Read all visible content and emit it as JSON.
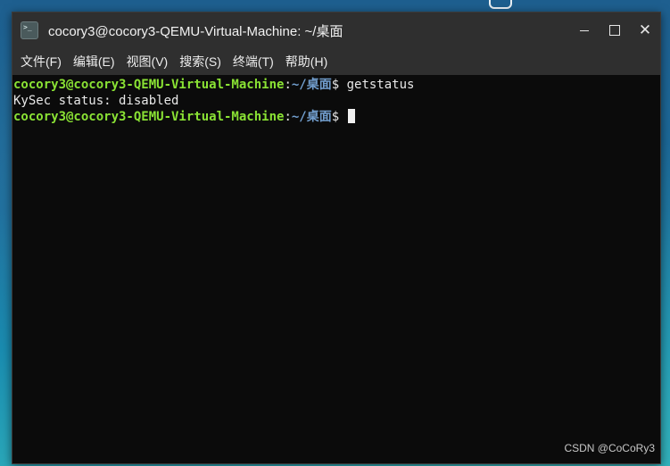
{
  "window": {
    "title": "cocory3@cocory3-QEMU-Virtual-Machine: ~/桌面",
    "controls": {
      "close_glyph": "✕"
    }
  },
  "menu": {
    "items": [
      {
        "label": "文件(F)"
      },
      {
        "label": "编辑(E)"
      },
      {
        "label": "视图(V)"
      },
      {
        "label": "搜索(S)"
      },
      {
        "label": "终端(T)"
      },
      {
        "label": "帮助(H)"
      }
    ]
  },
  "terminal": {
    "lines": [
      {
        "type": "prompt",
        "user_host": "cocory3@cocory3-QEMU-Virtual-Machine",
        "separator": ":",
        "path": "~/桌面",
        "symbol": "$ ",
        "command": "getstatus"
      },
      {
        "type": "output",
        "text": "KySec status: disabled"
      },
      {
        "type": "prompt",
        "user_host": "cocory3@cocory3-QEMU-Virtual-Machine",
        "separator": ":",
        "path": "~/桌面",
        "symbol": "$ ",
        "command": ""
      }
    ]
  },
  "watermark": "CSDN @CoCoRy3",
  "colors": {
    "prompt_user": "#8ae234",
    "prompt_path": "#729fcf",
    "terminal_bg": "#0b0b0b",
    "titlebar_bg": "#2f2f2f"
  }
}
